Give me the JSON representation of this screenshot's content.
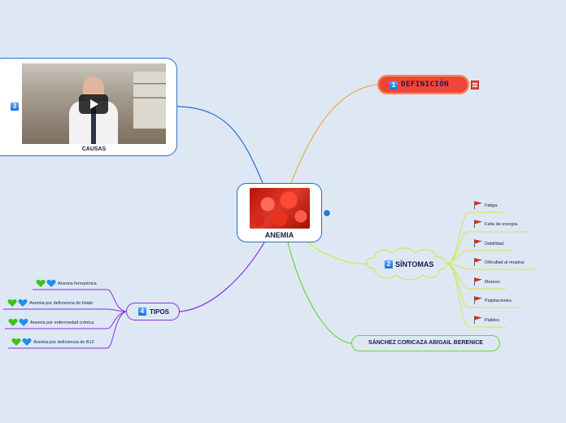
{
  "central": {
    "label": "ANEMIA"
  },
  "definicion": {
    "number": "1",
    "label": "DEFINICIÓN"
  },
  "sintomas": {
    "number": "2",
    "label": "SÍNTOMAS",
    "items": [
      "Fatiga.",
      "Falta de energía.",
      "Debilidad.",
      "Dificultad al respirar.",
      "Mareos.",
      "Palpitaciones.",
      "Palidez."
    ]
  },
  "causas": {
    "number": "3",
    "label": "CAUSAS"
  },
  "tipos": {
    "number": "4",
    "label": "TIPOS",
    "items": [
      "Anemia ferropénica",
      "Anemia por deficiencia de folato",
      "Anemia por enfermedad crónica",
      "Anemia por deficiencia de B12"
    ]
  },
  "author": {
    "label": "SÁNCHEZ CORICAZA ABIGAIL BERENICE"
  },
  "colors": {
    "background": "#dde8f4",
    "branch_definicion": "#e7862a",
    "branch_sintomas": "#d4e84a",
    "branch_causas": "#2a6fc4",
    "branch_tipos": "#8a2be2",
    "branch_author": "#6ed23a",
    "definicion_fill": "#f1453a"
  },
  "icons": {
    "note": "note-icon",
    "flag": "red-flag-icon",
    "hearts": "green-blue-hearts-icon",
    "video_play": "play-icon",
    "collapse": "collapse-toggle-icon"
  }
}
